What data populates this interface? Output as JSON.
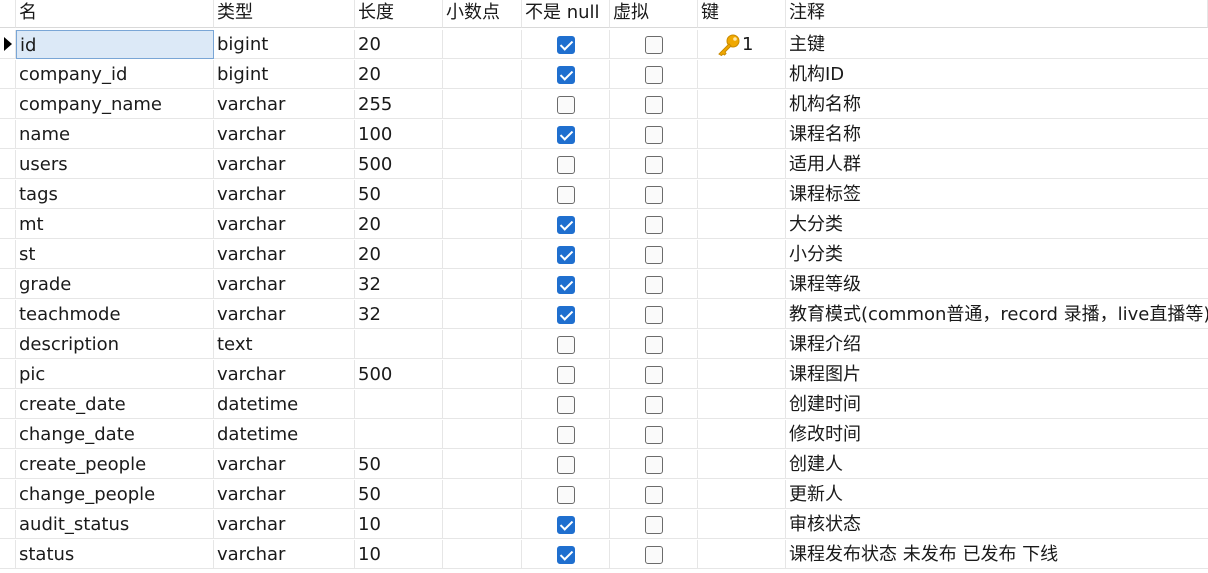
{
  "columns": {
    "name": "名",
    "type": "类型",
    "length": "长度",
    "decimal": "小数点",
    "not_null": "不是 null",
    "virtual": "虚拟",
    "key": "键",
    "comment": "注释"
  },
  "rows": [
    {
      "name": "id",
      "type": "bigint",
      "length": "20",
      "decimal": "",
      "not_null": true,
      "virtual": false,
      "key": "1",
      "comment": "主键",
      "selected": true
    },
    {
      "name": "company_id",
      "type": "bigint",
      "length": "20",
      "decimal": "",
      "not_null": true,
      "virtual": false,
      "key": "",
      "comment": "机构ID"
    },
    {
      "name": "company_name",
      "type": "varchar",
      "length": "255",
      "decimal": "",
      "not_null": false,
      "virtual": false,
      "key": "",
      "comment": "机构名称"
    },
    {
      "name": "name",
      "type": "varchar",
      "length": "100",
      "decimal": "",
      "not_null": true,
      "virtual": false,
      "key": "",
      "comment": "课程名称"
    },
    {
      "name": "users",
      "type": "varchar",
      "length": "500",
      "decimal": "",
      "not_null": false,
      "virtual": false,
      "key": "",
      "comment": "适用人群"
    },
    {
      "name": "tags",
      "type": "varchar",
      "length": "50",
      "decimal": "",
      "not_null": false,
      "virtual": false,
      "key": "",
      "comment": "课程标签"
    },
    {
      "name": "mt",
      "type": "varchar",
      "length": "20",
      "decimal": "",
      "not_null": true,
      "virtual": false,
      "key": "",
      "comment": "大分类"
    },
    {
      "name": "st",
      "type": "varchar",
      "length": "20",
      "decimal": "",
      "not_null": true,
      "virtual": false,
      "key": "",
      "comment": "小分类"
    },
    {
      "name": "grade",
      "type": "varchar",
      "length": "32",
      "decimal": "",
      "not_null": true,
      "virtual": false,
      "key": "",
      "comment": "课程等级"
    },
    {
      "name": "teachmode",
      "type": "varchar",
      "length": "32",
      "decimal": "",
      "not_null": true,
      "virtual": false,
      "key": "",
      "comment": "教育模式(common普通，record 录播，live直播等)"
    },
    {
      "name": "description",
      "type": "text",
      "length": "",
      "decimal": "",
      "not_null": false,
      "virtual": false,
      "key": "",
      "comment": "课程介绍"
    },
    {
      "name": "pic",
      "type": "varchar",
      "length": "500",
      "decimal": "",
      "not_null": false,
      "virtual": false,
      "key": "",
      "comment": "课程图片"
    },
    {
      "name": "create_date",
      "type": "datetime",
      "length": "",
      "decimal": "",
      "not_null": false,
      "virtual": false,
      "key": "",
      "comment": "创建时间"
    },
    {
      "name": "change_date",
      "type": "datetime",
      "length": "",
      "decimal": "",
      "not_null": false,
      "virtual": false,
      "key": "",
      "comment": "修改时间"
    },
    {
      "name": "create_people",
      "type": "varchar",
      "length": "50",
      "decimal": "",
      "not_null": false,
      "virtual": false,
      "key": "",
      "comment": "创建人"
    },
    {
      "name": "change_people",
      "type": "varchar",
      "length": "50",
      "decimal": "",
      "not_null": false,
      "virtual": false,
      "key": "",
      "comment": "更新人"
    },
    {
      "name": "audit_status",
      "type": "varchar",
      "length": "10",
      "decimal": "",
      "not_null": true,
      "virtual": false,
      "key": "",
      "comment": "审核状态"
    },
    {
      "name": "status",
      "type": "varchar",
      "length": "10",
      "decimal": "",
      "not_null": true,
      "virtual": false,
      "key": "",
      "comment": "课程发布状态 未发布  已发布 下线"
    }
  ],
  "colors": {
    "checkbox_checked": "#1f6fcf",
    "selection_fill": "#dce9f7",
    "key_icon": "#f0a800"
  },
  "icons": {
    "row_marker": "current-row-arrow-icon",
    "key": "primary-key-icon"
  }
}
